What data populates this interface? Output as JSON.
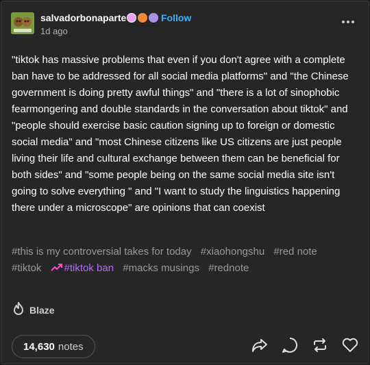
{
  "post": {
    "username": "salvadorbonaparte",
    "follow_label": "Follow",
    "timestamp": "1d ago",
    "body": "\"tiktok has massive problems that even if you don't agree with a complete ban have to be addressed for all social media platforms\" and \"the Chinese government is doing pretty awful things\" and \"there is a lot of sinophobic fearmongering and double standards in the conversation about tiktok\" and \"people should exercise basic caution signing up to foreign or domestic social media\" and \"most Chinese citizens like US citizens are just people living their life and cultural exchange between them can be beneficial for both sides\" and \"some people being on the same social media site isn't going to solve everything \" and \"I want to study the linguistics happening there under a microscope\" are opinions that can coexist",
    "tags": [
      "#this is my controversial takes for today",
      "#xiaohongshu",
      "#red note",
      "#tiktok",
      "#tiktok ban",
      "#macks musings",
      "#rednote"
    ],
    "blaze_label": "Blaze",
    "notes_count": "14,630",
    "notes_label": "notes"
  },
  "colors": {
    "background": "#262626",
    "accent_blue": "#3fb0f8",
    "trending_pink": "#ff4dd0",
    "trending_purple": "#b36bff"
  },
  "icons": [
    "more-icon",
    "trending-icon",
    "flame-icon",
    "share-icon",
    "reply-icon",
    "reblog-icon",
    "like-icon"
  ]
}
